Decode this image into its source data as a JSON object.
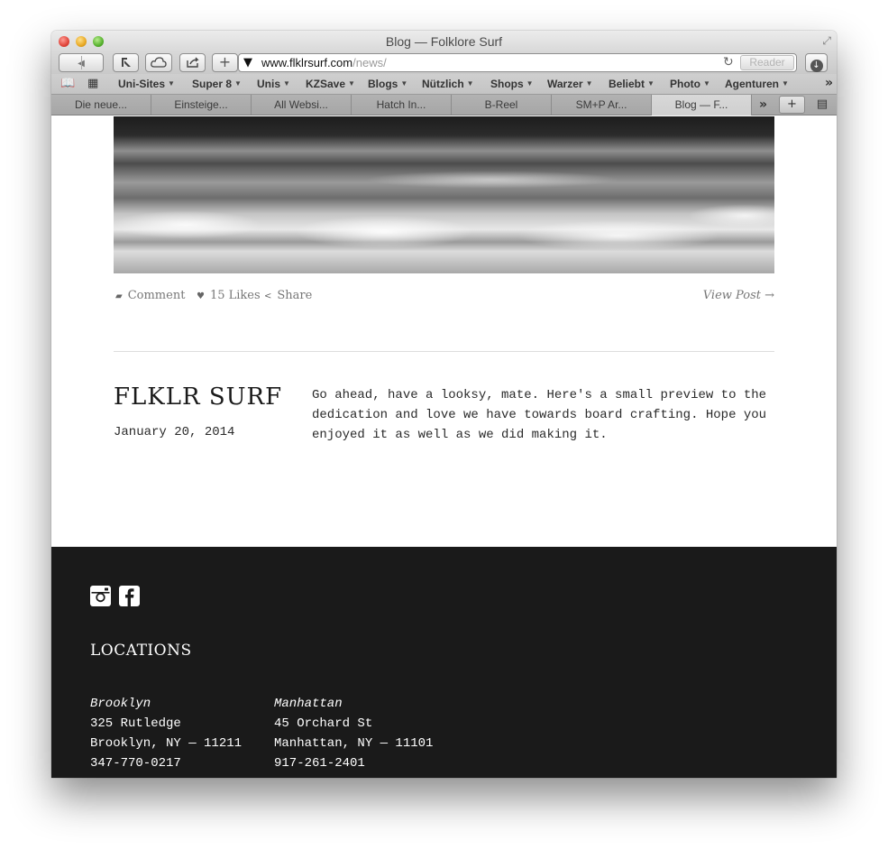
{
  "window": {
    "title": "Blog — Folklore Surf"
  },
  "toolbar": {
    "back_icon": "◀",
    "forward_icon": "▶",
    "url_host": "www.flklrsurf.com",
    "url_path": "/news/",
    "reader_label": "Reader"
  },
  "bookmarks": [
    {
      "label": "Uni-Sites"
    },
    {
      "label": "Super 8"
    },
    {
      "label": "Unis"
    },
    {
      "label": "KZSave"
    },
    {
      "label": "Blogs"
    },
    {
      "label": "Nützlich"
    },
    {
      "label": "Shops"
    },
    {
      "label": "Warzer"
    },
    {
      "label": "Beliebt"
    },
    {
      "label": "Photo"
    },
    {
      "label": "Agenturen"
    }
  ],
  "tabs": [
    {
      "label": "Die neue..."
    },
    {
      "label": "Einsteige..."
    },
    {
      "label": "All Websi..."
    },
    {
      "label": "Hatch In..."
    },
    {
      "label": "B-Reel"
    },
    {
      "label": "SM+P Ar..."
    },
    {
      "label": "Blog — F..."
    }
  ],
  "post": {
    "comment_label": "Comment",
    "likes_label": "15 Likes",
    "share_label": "Share",
    "view_post_label": "View Post →",
    "title": "FLKLR SURF",
    "date": "January 20, 2014",
    "body_lines": [
      "Go ahead, have a looksy, mate. Here's a small preview to the",
      "dedication and love we have towards board crafting. Hope you",
      "enjoyed it as well as we did making it."
    ]
  },
  "footer": {
    "social_icons": [
      "instagram-icon",
      "facebook-icon"
    ],
    "locations_title": "LOCATIONS",
    "locations": [
      {
        "name": "Brooklyn",
        "street": "325 Rutledge",
        "city": "Brooklyn, NY — 11211",
        "phone": "347-770-0217"
      },
      {
        "name": "Manhattan",
        "street": "45 Orchard St",
        "city": "Manhattan, NY — 11101",
        "phone": "917-261-2401"
      }
    ]
  }
}
